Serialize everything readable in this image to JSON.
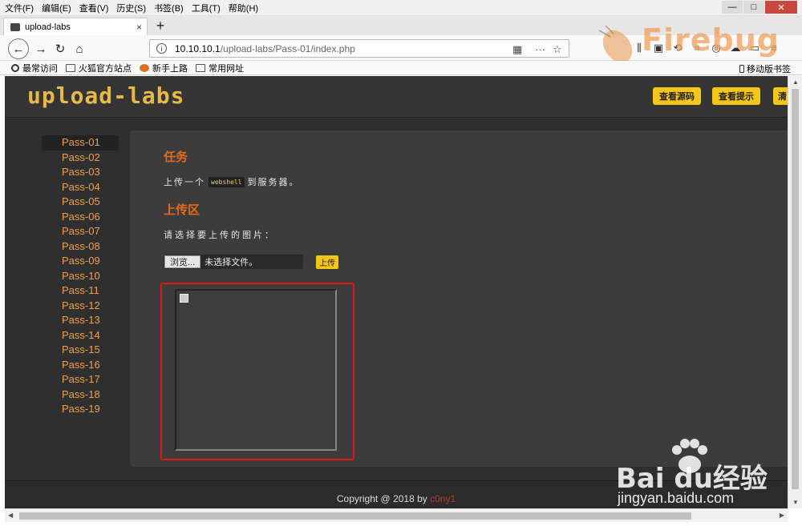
{
  "menubar": {
    "items": [
      "文件(F)",
      "编辑(E)",
      "查看(V)",
      "历史(S)",
      "书签(B)",
      "工具(T)",
      "帮助(H)"
    ]
  },
  "tab": {
    "title": "upload-labs",
    "close": "×",
    "new": "+"
  },
  "address": {
    "host": "10.10.10.1",
    "path": "/upload-labs/Pass-01/index.php"
  },
  "bookmarks": {
    "items": [
      "最常访问",
      "火狐官方站点",
      "新手上路",
      "常用网址"
    ],
    "mobile": "移动版书签"
  },
  "watermark_firebug": "Firebug",
  "site": {
    "logo": "upload-labs",
    "buttons": [
      "查看源码",
      "查看提示",
      "清"
    ]
  },
  "sidebar": {
    "items": [
      "Pass-01",
      "Pass-02",
      "Pass-03",
      "Pass-04",
      "Pass-05",
      "Pass-06",
      "Pass-07",
      "Pass-08",
      "Pass-09",
      "Pass-10",
      "Pass-11",
      "Pass-12",
      "Pass-13",
      "Pass-14",
      "Pass-15",
      "Pass-16",
      "Pass-17",
      "Pass-18",
      "Pass-19"
    ],
    "active": "Pass-01"
  },
  "main": {
    "task_heading": "任务",
    "task_prefix": "上传一个",
    "task_code": "webshell",
    "task_suffix": "到服务器。",
    "upload_heading": "上传区",
    "choose_text": "请选择要上传的图片：",
    "browse_label": "浏览...",
    "file_status": "未选择文件。",
    "upload_label": "上传"
  },
  "footer": {
    "copyright": "Copyright @ 2018 by ",
    "author": "c0ny1"
  },
  "watermark_baidu": {
    "logo": "Bai du经验",
    "url": "jingyan.baidu.com"
  },
  "colors": {
    "accent_orange": "#e8691a",
    "sidebar_link": "#f0a050",
    "button_yellow": "#f5c518",
    "highlight_red": "#e01818",
    "page_bg": "#2f2f2f"
  }
}
